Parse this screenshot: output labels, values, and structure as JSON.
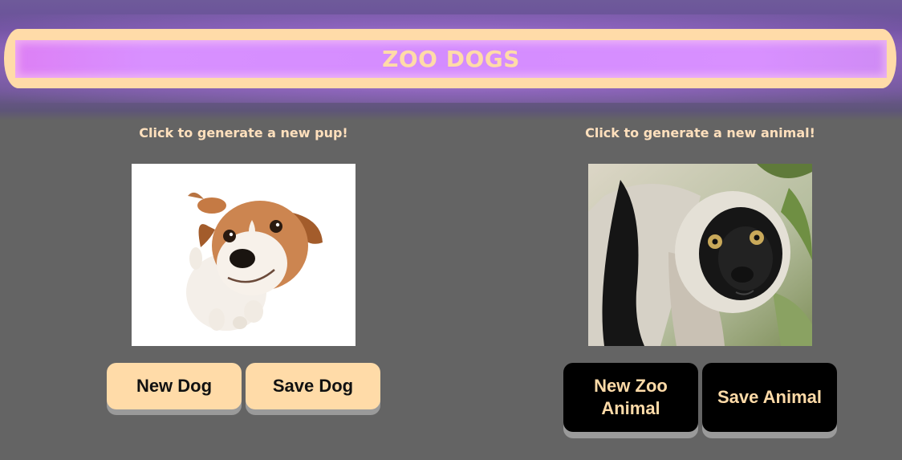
{
  "header": {
    "title": "ZOO DOGS"
  },
  "dog_section": {
    "prompt": "Click to generate a new pup!",
    "image_alt": "dog photo",
    "new_button": "New Dog",
    "save_button": "Save Dog"
  },
  "zoo_section": {
    "prompt": "Click to generate a new animal!",
    "image_alt": "lemur photo",
    "new_button": "New Zoo Animal",
    "save_button": "Save Animal"
  },
  "colors": {
    "background": "#646464",
    "header_purple": "#d48cff",
    "accent_peach": "#ffdba8",
    "dark_button": "#000000"
  }
}
